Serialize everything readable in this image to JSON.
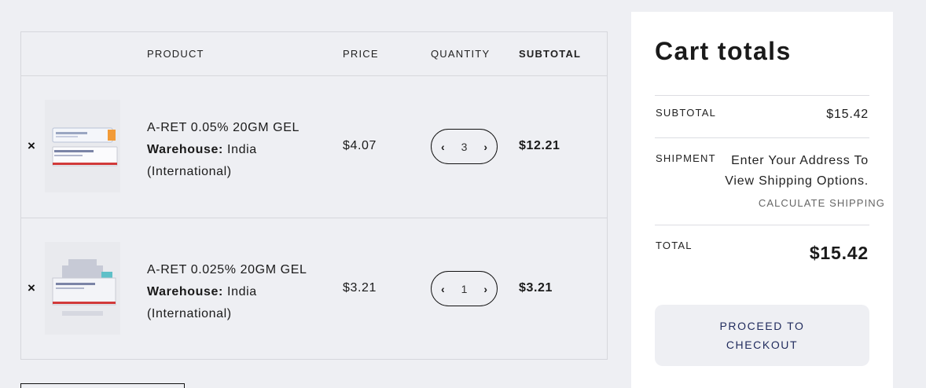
{
  "table": {
    "headers": {
      "product": "PRODUCT",
      "price": "PRICE",
      "quantity": "QUANTITY",
      "subtotal": "SUBTOTAL"
    },
    "rows": [
      {
        "remove": "×",
        "name": "A-RET 0.05% 20GM GEL",
        "warehouse_label": "Warehouse:",
        "warehouse_value": "India (International)",
        "price": "$4.07",
        "quantity": "3",
        "subtotal": "$12.21"
      },
      {
        "remove": "×",
        "name": "A-RET 0.025% 20GM GEL",
        "warehouse_label": "Warehouse:",
        "warehouse_value": "India (International)",
        "price": "$3.21",
        "quantity": "1",
        "subtotal": "$3.21"
      }
    ]
  },
  "totals": {
    "title": "Cart totals",
    "subtotal_label": "SUBTOTAL",
    "subtotal_value": "$15.42",
    "shipment_label": "SHIPMENT",
    "shipment_text": "Enter Your Address To View Shipping Options.",
    "calculate_link": "CALCULATE SHIPPING",
    "total_label": "TOTAL",
    "total_value": "$15.42",
    "checkout_label": "PROCEED TO CHECKOUT"
  },
  "icons": {
    "remove": "close-icon",
    "decrease": "chevron-left-icon",
    "increase": "chevron-right-icon"
  },
  "colors": {
    "page_bg": "#eeeff3",
    "panel_bg": "#ffffff",
    "checkout_text": "#1f2a5c",
    "border": "#d6d7dc"
  }
}
